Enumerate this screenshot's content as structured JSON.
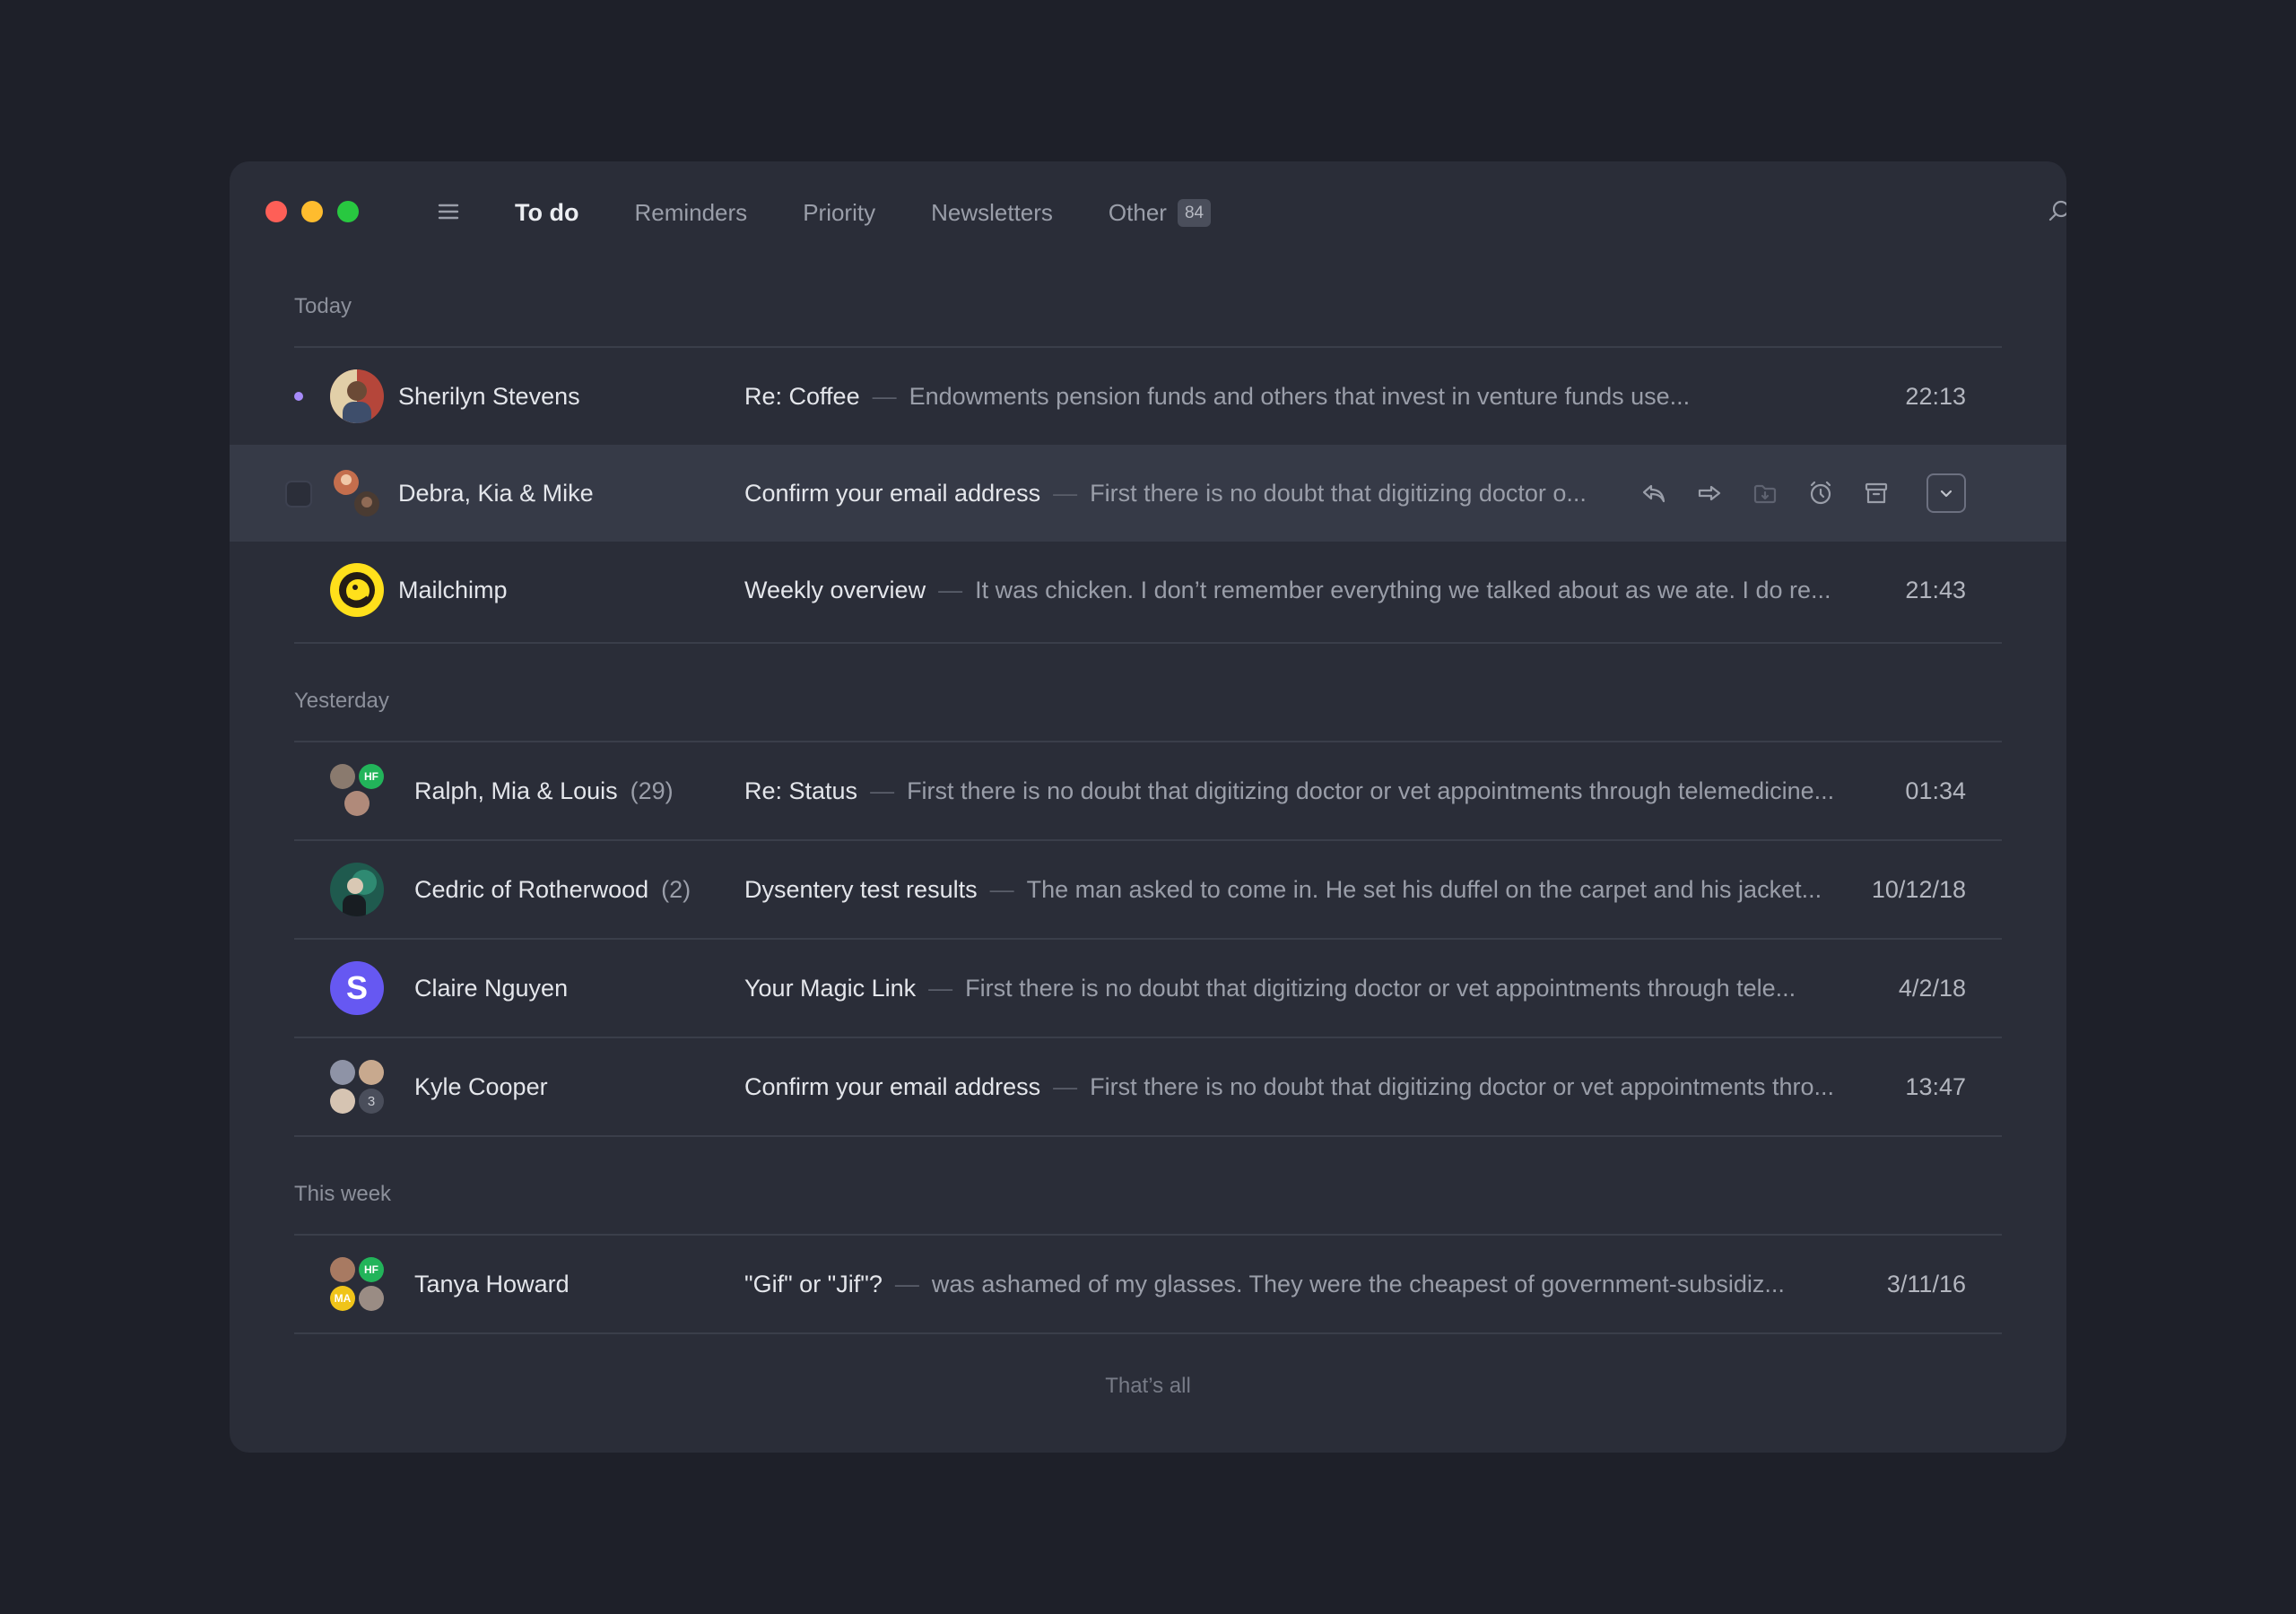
{
  "window": {
    "tabs": [
      {
        "label": "To do",
        "active": true
      },
      {
        "label": "Reminders",
        "active": false
      },
      {
        "label": "Priority",
        "active": false
      },
      {
        "label": "Newsletters",
        "active": false
      },
      {
        "label": "Other",
        "active": false,
        "badge": "84"
      }
    ],
    "icons": [
      "menu-icon",
      "search-icon",
      "compose-icon",
      "bell-icon"
    ]
  },
  "sections": [
    {
      "label": "Today"
    },
    {
      "label": "Yesterday"
    },
    {
      "label": "This week"
    }
  ],
  "emails": [
    {
      "sender": "Sherilyn Stevens",
      "count": "",
      "subject": "Re: Coffee",
      "preview": "Endowments pension funds and others that invest in venture funds use...",
      "time": "22:13",
      "unread": true
    },
    {
      "sender": "Debra, Kia & Mike",
      "count": "",
      "subject": "Confirm your email address",
      "preview": "First there is no doubt that digitizing doctor o...",
      "time": "",
      "hovered": true
    },
    {
      "sender": "Mailchimp",
      "count": "",
      "subject": "Weekly overview",
      "preview": "It was chicken. I don’t remember everything we talked about as we ate. I do re...",
      "time": "21:43"
    },
    {
      "sender": "Ralph, Mia & Louis",
      "count": "(29)",
      "subject": "Re: Status",
      "preview": "First there is no doubt that digitizing doctor or vet appointments through telemedicine...",
      "time": "01:34",
      "avatar_badge": "HF"
    },
    {
      "sender": "Cedric of Rotherwood",
      "count": "(2)",
      "subject": "Dysentery test results",
      "preview": "The man asked to come in. He set his duffel on the carpet and his jacket...",
      "time": "10/12/18"
    },
    {
      "sender": "Claire Nguyen",
      "count": "",
      "subject": "Your Magic Link",
      "preview": "First there is no doubt that digitizing doctor or vet appointments through tele...",
      "time": "4/2/18",
      "avatar_letter": "S"
    },
    {
      "sender": "Kyle Cooper",
      "count": "",
      "subject": "Confirm your email address",
      "preview": "First there is no doubt that digitizing doctor or vet appointments thro...",
      "time": "13:47",
      "avatar_more": "3"
    },
    {
      "sender": "Tanya Howard",
      "count": "",
      "subject": "\"Gif\" or \"Jif\"?",
      "preview": "was ashamed of my glasses. They were the cheapest of government-subsidiz...",
      "time": "3/11/16",
      "avatar_badge": "HF",
      "avatar_badge2": "MA"
    }
  ],
  "separator": "—",
  "hover_actions": [
    "reply-icon",
    "forward-icon",
    "move-to-folder-icon",
    "snooze-icon",
    "archive-icon",
    "chevron-down-icon"
  ],
  "footer": "That’s all",
  "colors": {
    "background": "#1e2029",
    "window": "#2a2d38",
    "unread_dot": "#a78bfa",
    "claire_avatar": "#6658f2",
    "mailchimp_avatar": "#ffe01b"
  }
}
